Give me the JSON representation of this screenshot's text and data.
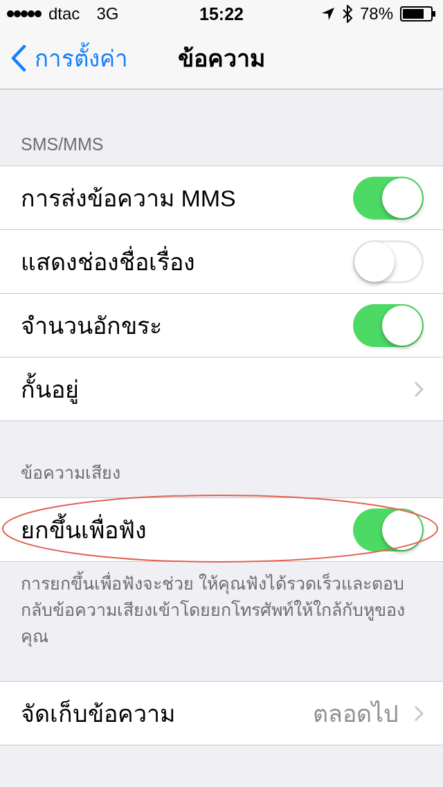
{
  "status_bar": {
    "carrier": "dtac",
    "network": "3G",
    "time": "15:22",
    "battery": "78%"
  },
  "nav": {
    "back": "การตั้งค่า",
    "title": "ข้อความ"
  },
  "sections": [
    {
      "header": "SMS/MMS",
      "rows": [
        {
          "kind": "toggle",
          "label": "การส่งข้อความ MMS",
          "on": true
        },
        {
          "kind": "toggle",
          "label": "แสดงช่องชื่อเรื่อง",
          "on": false
        },
        {
          "kind": "toggle",
          "label": "จำนวนอักขระ",
          "on": true
        },
        {
          "kind": "link",
          "label": "กั้นอยู่"
        }
      ]
    },
    {
      "header": "ข้อความเสียง",
      "rows": [
        {
          "kind": "toggle",
          "label": "ยกขึ้นเพื่อฟัง",
          "on": true,
          "circled": true
        }
      ],
      "footer": "การยกขึ้นเพื่อฟังจะช่วย ให้คุณฟังได้รวดเร็วและตอบกลับข้อความเสียงเข้าโดยยกโทรศัพท์ให้ใกล้กับหูของคุณ"
    },
    {
      "rows": [
        {
          "kind": "link",
          "label": "จัดเก็บข้อความ",
          "value": "ตลอดไป"
        }
      ]
    }
  ]
}
